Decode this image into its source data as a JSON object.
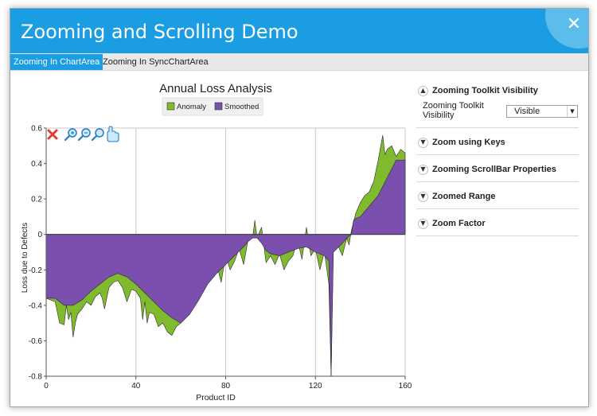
{
  "window": {
    "title": "Zooming and Scrolling Demo",
    "close_glyph": "✕"
  },
  "tabs": [
    {
      "label": "Zooming In ChartArea",
      "active": true
    },
    {
      "label": "Zooming In SyncChartArea",
      "active": false
    }
  ],
  "chart": {
    "title": "Annual Loss Analysis",
    "toolbar_icons": [
      "reset-zoom-icon",
      "zoom-in-icon",
      "zoom-out-icon",
      "zoom-fit-icon",
      "pan-hand-icon"
    ]
  },
  "chart_data": {
    "type": "area",
    "title": "Annual Loss Analysis",
    "xlabel": "Product ID",
    "ylabel": "Loss due to Defects",
    "xlim": [
      0,
      160
    ],
    "ylim": [
      -0.8,
      0.6
    ],
    "xticks": [
      "0",
      "40",
      "80",
      "120",
      "160"
    ],
    "yticks": [
      "0.6",
      "0.4",
      "0.2",
      "0",
      "-0.2",
      "-0.4",
      "-0.6",
      "-0.8"
    ],
    "grid": true,
    "legend": "top-center",
    "series": [
      {
        "name": "Anomaly",
        "color": "#7fba2f",
        "x": [
          0,
          4,
          6,
          8,
          9,
          10,
          11,
          12,
          13,
          14,
          16,
          18,
          20,
          22,
          24,
          25,
          26,
          28,
          30,
          32,
          34,
          36,
          38,
          40,
          42,
          43,
          44,
          45,
          46,
          48,
          50,
          52,
          54,
          56,
          58,
          60,
          62,
          64,
          66,
          68,
          70,
          72,
          74,
          76,
          78,
          80,
          82,
          84,
          86,
          88,
          90,
          92,
          93,
          94,
          96,
          98,
          100,
          102,
          104,
          106,
          108,
          110,
          112,
          114,
          116,
          118,
          120,
          122,
          124,
          126,
          127,
          128,
          130,
          132,
          134,
          135,
          136,
          138,
          140,
          142,
          144,
          146,
          148,
          150,
          151,
          152,
          154,
          156,
          158,
          160
        ],
        "values": [
          -0.36,
          -0.38,
          -0.5,
          -0.51,
          -0.4,
          -0.48,
          -0.44,
          -0.58,
          -0.5,
          -0.45,
          -0.42,
          -0.38,
          -0.4,
          -0.35,
          -0.33,
          -0.36,
          -0.42,
          -0.3,
          -0.27,
          -0.26,
          -0.3,
          -0.38,
          -0.31,
          -0.32,
          -0.36,
          -0.48,
          -0.38,
          -0.5,
          -0.44,
          -0.45,
          -0.52,
          -0.5,
          -0.55,
          -0.57,
          -0.52,
          -0.5,
          -0.44,
          -0.4,
          -0.3,
          -0.32,
          -0.25,
          -0.22,
          -0.2,
          -0.17,
          -0.27,
          -0.12,
          -0.2,
          -0.15,
          -0.08,
          -0.17,
          -0.03,
          -0.02,
          0.08,
          -0.02,
          0.04,
          -0.16,
          -0.12,
          -0.17,
          -0.11,
          -0.2,
          -0.15,
          -0.12,
          -0.03,
          -0.14,
          0.04,
          -0.12,
          -0.08,
          -0.2,
          -0.1,
          -0.28,
          -0.8,
          -0.05,
          -0.06,
          -0.12,
          -0.02,
          -0.06,
          0.02,
          0.12,
          0.18,
          0.22,
          0.24,
          0.3,
          0.42,
          0.56,
          0.45,
          0.48,
          0.5,
          0.44,
          0.48,
          0.46
        ]
      },
      {
        "name": "Smoothed",
        "color": "#7b4fae",
        "x": [
          0,
          4,
          8,
          12,
          16,
          20,
          24,
          28,
          32,
          36,
          40,
          44,
          48,
          52,
          56,
          60,
          64,
          68,
          72,
          76,
          80,
          84,
          88,
          90,
          92,
          94,
          96,
          98,
          100,
          104,
          108,
          112,
          116,
          120,
          124,
          126,
          127,
          128,
          132,
          134,
          136,
          137,
          138,
          140,
          144,
          148,
          152,
          156,
          160
        ],
        "values": [
          -0.36,
          -0.36,
          -0.4,
          -0.4,
          -0.37,
          -0.32,
          -0.28,
          -0.24,
          -0.22,
          -0.24,
          -0.28,
          -0.33,
          -0.38,
          -0.43,
          -0.47,
          -0.5,
          -0.45,
          -0.37,
          -0.28,
          -0.22,
          -0.17,
          -0.12,
          -0.07,
          -0.04,
          -0.02,
          -0.02,
          -0.05,
          -0.09,
          -0.11,
          -0.12,
          -0.1,
          -0.08,
          -0.07,
          -0.1,
          -0.12,
          -0.15,
          -0.8,
          -0.1,
          -0.05,
          -0.02,
          0.0,
          0.08,
          0.09,
          0.1,
          0.16,
          0.22,
          0.32,
          0.42,
          0.42
        ]
      }
    ]
  },
  "panel": {
    "sections": [
      {
        "title": "Zooming Toolkit Visibility",
        "expanded": true,
        "chevron": "▲",
        "row_label": "Zooming Toolkit Visibility",
        "row_value": "Visible",
        "dropdown_arrow": "▼"
      },
      {
        "title": "Zoom using Keys",
        "expanded": false,
        "chevron": "▼"
      },
      {
        "title": "Zooming ScrollBar Properties",
        "expanded": false,
        "chevron": "▼"
      },
      {
        "title": "Zoomed Range",
        "expanded": false,
        "chevron": "▼"
      },
      {
        "title": "Zoom Factor",
        "expanded": false,
        "chevron": "▼"
      }
    ]
  }
}
